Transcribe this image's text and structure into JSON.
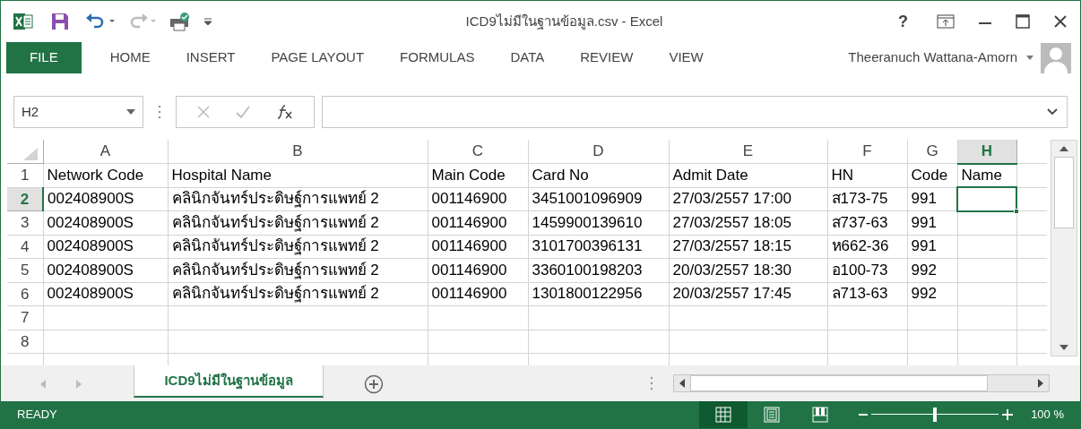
{
  "window": {
    "title": "ICD9ไม่มีในฐานข้อมูล.csv - Excel",
    "user": "Theeranuch Wattana-Amorn",
    "title_buttons": [
      {
        "kind": "help",
        "label": "?"
      }
    ]
  },
  "ribbon_tabs": [
    {
      "label": "FILE",
      "kind": "file"
    },
    {
      "label": "HOME",
      "kind": "tab",
      "selected": false
    },
    {
      "label": "INSERT",
      "kind": "tab",
      "selected": false
    },
    {
      "label": "PAGE LAYOUT",
      "kind": "tab",
      "selected": false
    },
    {
      "label": "FORMULAS",
      "kind": "tab",
      "selected": false
    },
    {
      "label": "DATA",
      "kind": "tab",
      "selected": false
    },
    {
      "label": "REVIEW",
      "kind": "tab",
      "selected": false
    },
    {
      "label": "VIEW",
      "kind": "tab",
      "selected": false
    }
  ],
  "formula_bar": {
    "name_box": "H2"
  },
  "sheet": {
    "columns": [
      {
        "label": "A",
        "selected": false
      },
      {
        "label": "B",
        "selected": false
      },
      {
        "label": "C",
        "selected": false
      },
      {
        "label": "D",
        "selected": false
      },
      {
        "label": "E",
        "selected": false
      },
      {
        "label": "F",
        "selected": false
      },
      {
        "label": "G",
        "selected": false
      },
      {
        "label": "H",
        "selected": true
      }
    ],
    "rows": [
      {
        "number": "1",
        "selected": false,
        "cells": [
          "Network Code",
          "Hospital Name",
          "Main Code",
          "Card No",
          "Admit Date",
          "HN",
          "Code",
          "Name"
        ]
      },
      {
        "number": "2",
        "selected": true,
        "cells": [
          "002408900S",
          "คลินิกจันทร์ประดิษฐ์การแพทย์ 2",
          "001146900",
          "3451001096909",
          "27/03/2557 17:00",
          "ส173-75",
          "991",
          ""
        ]
      },
      {
        "number": "3",
        "selected": false,
        "cells": [
          "002408900S",
          "คลินิกจันทร์ประดิษฐ์การแพทย์ 2",
          "001146900",
          "1459900139610",
          "27/03/2557 18:05",
          "ส737-63",
          "991",
          ""
        ]
      },
      {
        "number": "4",
        "selected": false,
        "cells": [
          "002408900S",
          "คลินิกจันทร์ประดิษฐ์การแพทย์ 2",
          "001146900",
          "3101700396131",
          "27/03/2557 18:15",
          "ห662-36",
          "991",
          ""
        ]
      },
      {
        "number": "5",
        "selected": false,
        "cells": [
          "002408900S",
          "คลินิกจันทร์ประดิษฐ์การแพทย์ 2",
          "001146900",
          "3360100198203",
          "20/03/2557 18:30",
          "อ100-73",
          "992",
          ""
        ]
      },
      {
        "number": "6",
        "selected": false,
        "cells": [
          "002408900S",
          "คลินิกจันทร์ประดิษฐ์การแพทย์ 2",
          "001146900",
          "1301800122956",
          "20/03/2557 17:45",
          "ล713-63",
          "992",
          ""
        ]
      },
      {
        "number": "7",
        "selected": false,
        "cells": [
          "",
          "",
          "",
          "",
          "",
          "",
          "",
          ""
        ]
      },
      {
        "number": "8",
        "selected": false,
        "cells": [
          "",
          "",
          "",
          "",
          "",
          "",
          "",
          ""
        ]
      }
    ]
  },
  "sheet_tabs": [
    {
      "label": "ICD9ไม่มีในฐานข้อมูล",
      "selected": true
    }
  ],
  "status_bar": {
    "status": "READY",
    "views": [
      {
        "kind": "normal",
        "selected": true
      },
      {
        "kind": "page_layout",
        "selected": false
      },
      {
        "kind": "page_break",
        "selected": false
      }
    ],
    "zoom": {
      "level": 0.5,
      "reading": "100 %"
    }
  }
}
